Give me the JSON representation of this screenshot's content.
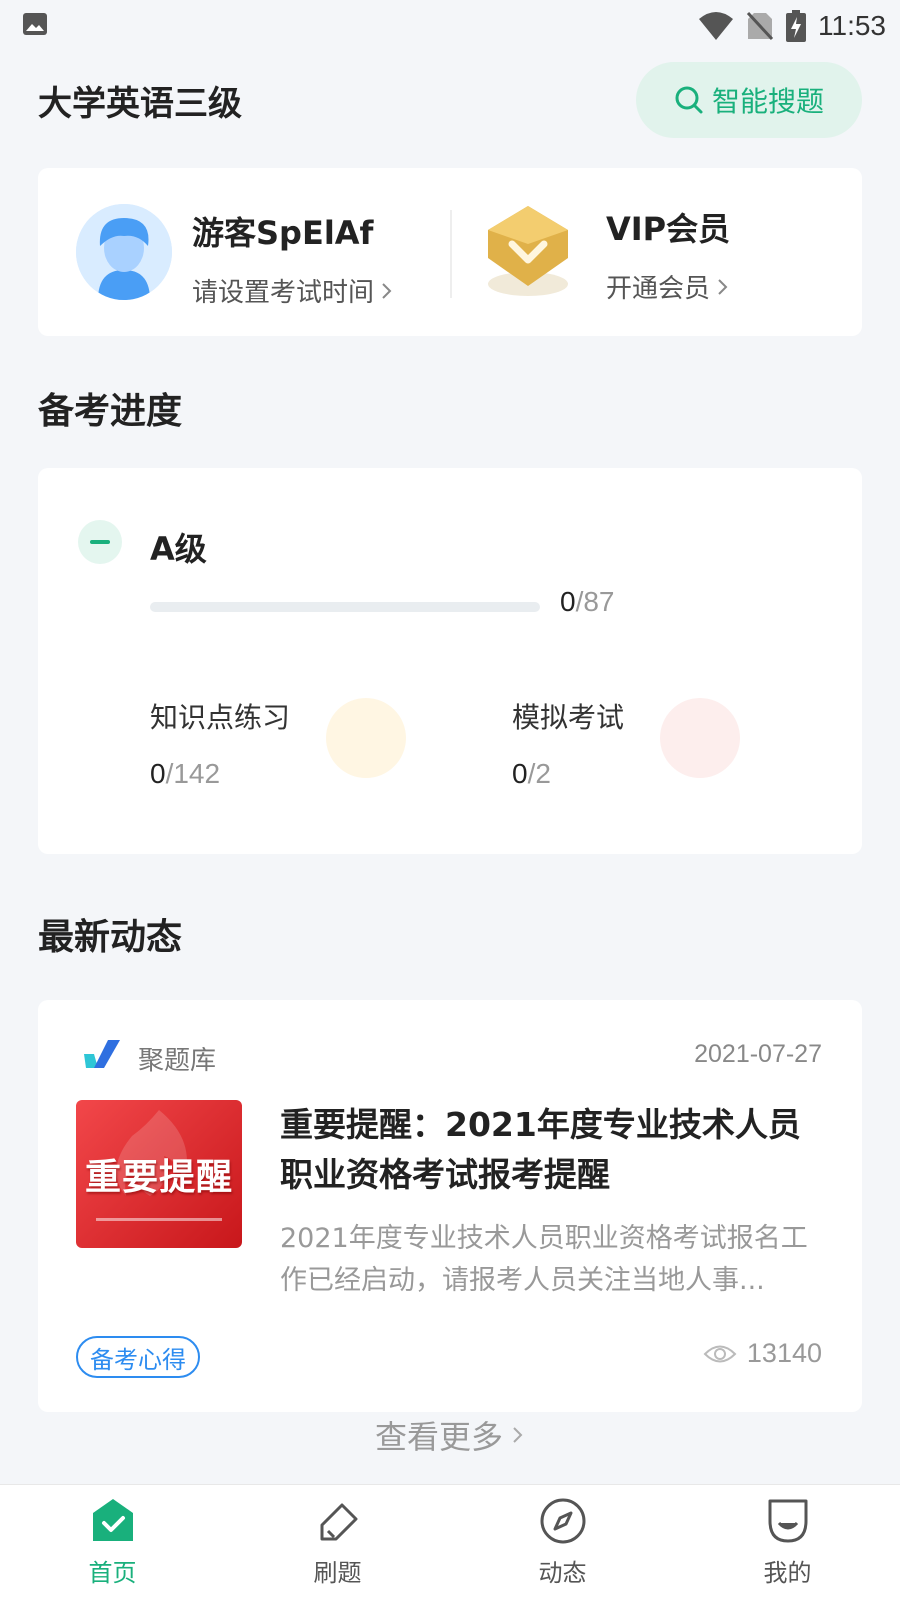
{
  "status_bar": {
    "time": "11:53"
  },
  "header": {
    "title": "大学英语三级",
    "search_label": "智能搜题"
  },
  "user_card": {
    "name": "游客SpElAf",
    "subtitle": "请设置考试时间",
    "vip_title": "VIP会员",
    "vip_subtitle": "开通会员"
  },
  "progress_section": {
    "title": "备考进度",
    "level": {
      "name": "A级",
      "done": "0",
      "sep": "/",
      "total": "87",
      "progress": 0
    },
    "stats": [
      {
        "label": "知识点练习",
        "done": "0",
        "sep": "/",
        "total": "142",
        "color": "#fff6e3"
      },
      {
        "label": "模拟考试",
        "done": "0",
        "sep": "/",
        "total": "2",
        "color": "#fdeeed"
      }
    ]
  },
  "news_section": {
    "title": "最新动态",
    "item": {
      "source": "聚题库",
      "date": "2021-07-27",
      "thumb_text": "重要提醒",
      "title": "重要提醒：2021年度专业技术人员职业资格考试报考提醒",
      "excerpt": "2021年度专业技术人员职业资格考试报名工作已经启动，请报考人员关注当地人事...",
      "tag": "备考心得",
      "views": "13140"
    },
    "more_label": "查看更多"
  },
  "tab_bar": {
    "tabs": [
      {
        "label": "首页",
        "icon": "home-icon",
        "active": true
      },
      {
        "label": "刷题",
        "icon": "pencil-icon",
        "active": false
      },
      {
        "label": "动态",
        "icon": "compass-icon",
        "active": false
      },
      {
        "label": "我的",
        "icon": "profile-icon",
        "active": false
      }
    ]
  },
  "colors": {
    "accent": "#19b07c",
    "tag_blue": "#2d8cf0",
    "background": "#f4f6f9"
  }
}
